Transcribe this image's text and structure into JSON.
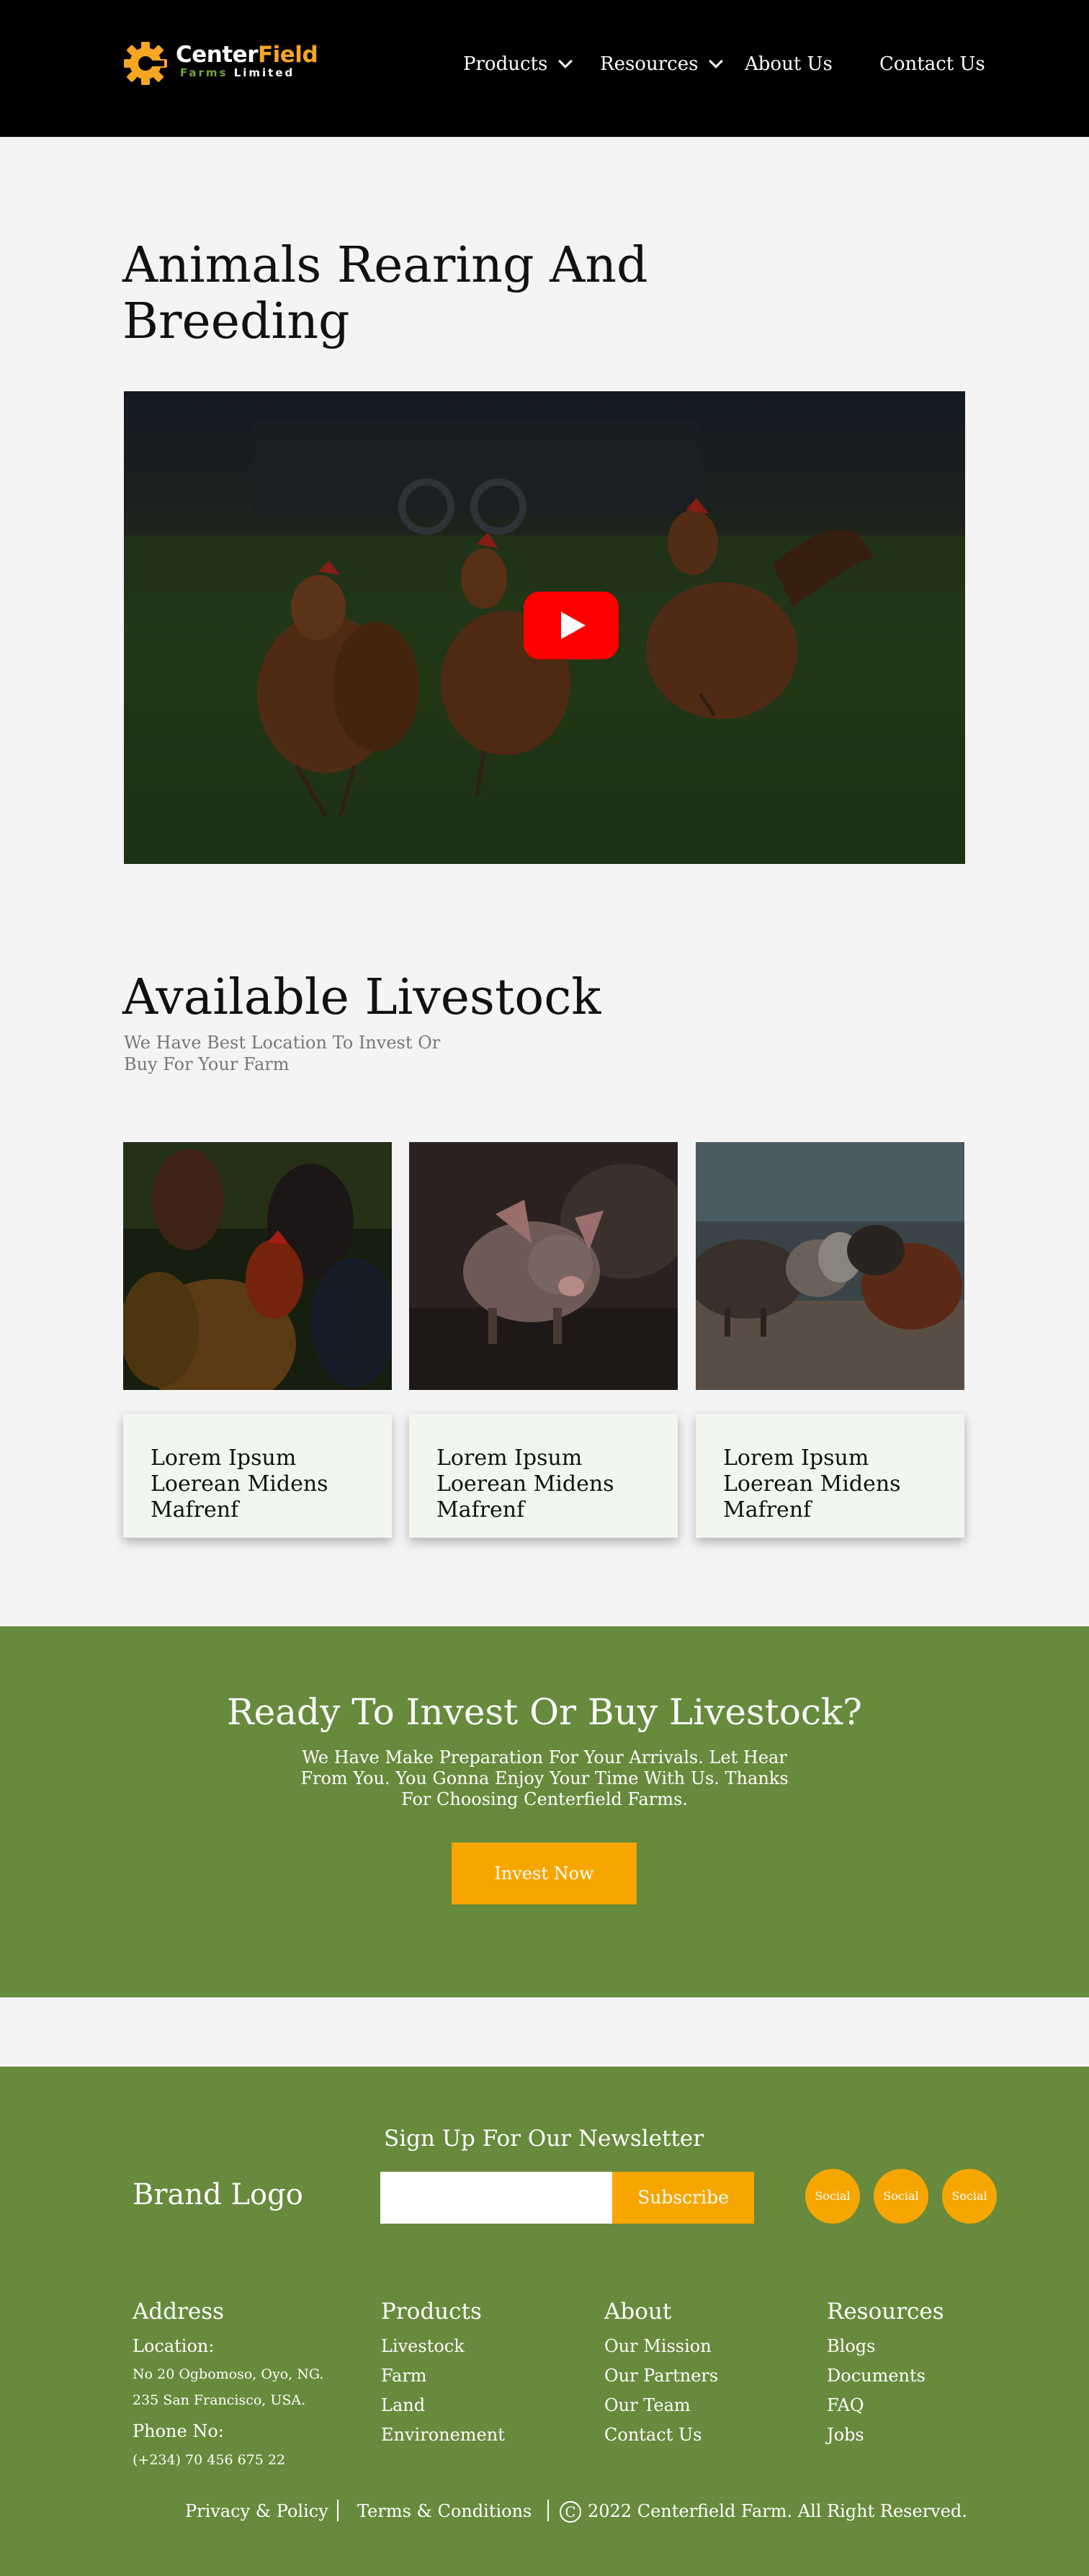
{
  "header": {
    "logo": {
      "word1_main": "Center",
      "word1_accent": "Field",
      "word2_green": "Farms",
      "word2_white": "Limited"
    },
    "nav": [
      {
        "label": "Products",
        "has_dropdown": true
      },
      {
        "label": "Resources",
        "has_dropdown": true
      },
      {
        "label": "About Us",
        "has_dropdown": false
      },
      {
        "label": "Contact Us",
        "has_dropdown": false
      }
    ]
  },
  "hero": {
    "title": "Animals Rearing And Breeding",
    "video_icon": "youtube-play-icon"
  },
  "livestock": {
    "title": "Available Livestock",
    "subtitle": "We Have Best Location To Invest Or Buy For Your Farm",
    "cards": [
      {
        "label": "Lorem Ipsum Loerean Midens Mafrenf"
      },
      {
        "label": "Lorem Ipsum Loerean Midens Mafrenf"
      },
      {
        "label": "Lorem Ipsum Loerean Midens Mafrenf"
      }
    ]
  },
  "cta": {
    "title": "Ready To Invest Or Buy Livestock?",
    "text": "We Have Make Preparation For Your Arrivals. Let Hear From You. You Gonna Enjoy Your Time With Us. Thanks For Choosing Centerfield Farms.",
    "button": "Invest Now"
  },
  "footer": {
    "brand_logo": "Brand Logo",
    "newsletter": {
      "title": "Sign Up For Our Newsletter",
      "placeholder": "",
      "button": "Subscribe"
    },
    "socials": [
      "Social",
      "Social",
      "Social"
    ],
    "address": {
      "title": "Address",
      "location_label": "Location:",
      "line1": "No 20 Ogbomoso, Oyo, NG.",
      "line2": "235 San Francisco, USA.",
      "phone_label": "Phone No:",
      "phone": "(+234) 70 456 675 22"
    },
    "products": {
      "title": "Products",
      "links": [
        "Livestock",
        "Farm",
        "Land",
        "Environement"
      ]
    },
    "about": {
      "title": "About",
      "links": [
        "Our Mission",
        "Our Partners",
        "Our Team",
        "Contact Us"
      ]
    },
    "resources": {
      "title": "Resources",
      "links": [
        "Blogs",
        "Documents",
        "FAQ",
        "Jobs"
      ]
    },
    "bottom": {
      "privacy": "Privacy & Policy",
      "terms": "Terms & Conditions",
      "copyright_symbol": "C",
      "copyright": "2022 Centerfield Farm. All Right Reserved."
    }
  },
  "colors": {
    "header_bg": "#000000",
    "page_bg": "#f4f4f4",
    "green": "#678a3c",
    "orange": "#f7a600",
    "card_bg": "#f1f7ef",
    "youtube_red": "#ff0000"
  }
}
